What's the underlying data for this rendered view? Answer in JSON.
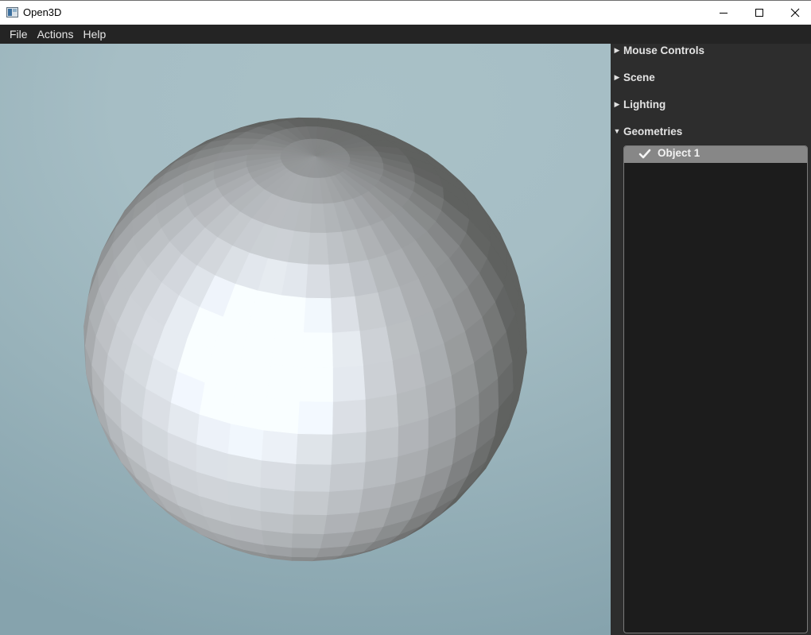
{
  "window": {
    "title": "Open3D",
    "icon": "app-icon",
    "controls": {
      "minimize_icon": "minimize-icon",
      "maximize_icon": "maximize-icon",
      "close_icon": "close-icon"
    }
  },
  "menubar": {
    "items": [
      {
        "label": "File"
      },
      {
        "label": "Actions"
      },
      {
        "label": "Help"
      }
    ]
  },
  "viewport": {
    "object": "sphere",
    "background_color": "#a6bec5",
    "object_color": "#ffffff"
  },
  "panel": {
    "sections": [
      {
        "label": "Mouse Controls",
        "expanded": false,
        "icon": "triangle-right-icon"
      },
      {
        "label": "Scene",
        "expanded": false,
        "icon": "triangle-right-icon"
      },
      {
        "label": "Lighting",
        "expanded": false,
        "icon": "triangle-right-icon"
      },
      {
        "label": "Geometries",
        "expanded": true,
        "icon": "triangle-down-icon"
      }
    ],
    "geometries": [
      {
        "label": "Object 1",
        "checked": true,
        "selected": true
      }
    ]
  },
  "colors": {
    "menubar_bg": "#242424",
    "panel_bg": "#2d2d2d",
    "tree_bg": "#1c1c1c",
    "selected_row": "#878787"
  }
}
